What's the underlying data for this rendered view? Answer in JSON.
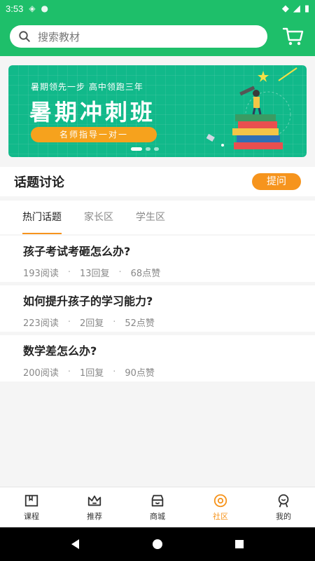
{
  "status": {
    "time": "3:53"
  },
  "search": {
    "placeholder": "搜索教材"
  },
  "banner": {
    "subtitle": "暑期领先一步 高中领跑三年",
    "title": "暑期冲刺班",
    "pill": "名师指导一对一",
    "slide_count": 3,
    "active_slide": 1
  },
  "topics": {
    "title": "话题讨论",
    "ask_label": "提问",
    "tabs": [
      {
        "label": "热门话题",
        "active": true
      },
      {
        "label": "家长区",
        "active": false
      },
      {
        "label": "学生区",
        "active": false
      }
    ],
    "posts": [
      {
        "question": "孩子考试考砸怎么办?",
        "reads": "193阅读",
        "replies": "13回复",
        "likes": "68点赞"
      },
      {
        "question": "如何提升孩子的学习能力?",
        "reads": "223阅读",
        "replies": "2回复",
        "likes": "52点赞"
      },
      {
        "question": "数学差怎么办?",
        "reads": "200阅读",
        "replies": "1回复",
        "likes": "90点赞"
      }
    ]
  },
  "bottom_nav": {
    "items": [
      {
        "label": "课程",
        "icon": "course-icon"
      },
      {
        "label": "推荐",
        "icon": "crown-icon"
      },
      {
        "label": "商城",
        "icon": "store-icon"
      },
      {
        "label": "社区",
        "icon": "community-icon",
        "active": true
      },
      {
        "label": "我的",
        "icon": "profile-icon"
      }
    ]
  },
  "colors": {
    "brand_green": "#1ebf6a",
    "accent_orange": "#f6941d",
    "banner_green": "#11b98a"
  }
}
